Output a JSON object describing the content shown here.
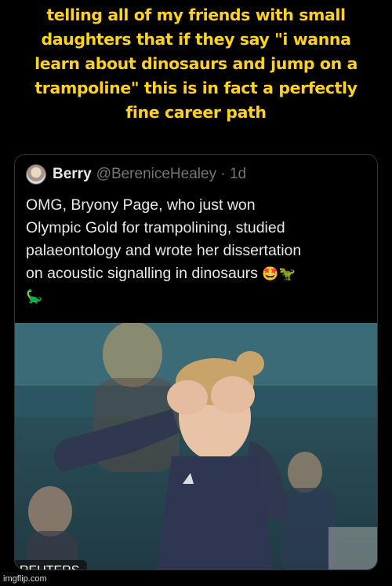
{
  "caption": {
    "lines": [
      "telling all of my friends with small",
      "daughters that if they say \"i wanna",
      "learn about dinosaurs and jump on a",
      "trampoline\" this is in fact a perfectly",
      "fine career path"
    ],
    "color": "#ffd21f"
  },
  "tweet": {
    "name": "Berry",
    "handle_time": "@BereniceHealey · 1d",
    "body_lines": [
      "OMG, Bryony Page, who just won",
      "Olympic Gold for trampolining, studied",
      "palaeontology and wrote her dissertation",
      "on acoustic signalling in dinosaurs"
    ],
    "emoji_inline": "🤩🦖",
    "emoji_line2": "🦕",
    "photo_credit": "REUTERS"
  },
  "watermark": "imgflip.com"
}
